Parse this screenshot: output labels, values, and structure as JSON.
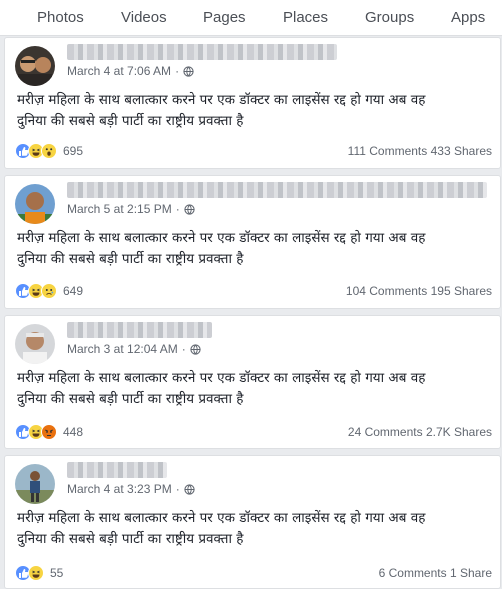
{
  "tabs": [
    "Photos",
    "Videos",
    "Pages",
    "Places",
    "Groups",
    "Apps"
  ],
  "posts": [
    {
      "timestamp": "March 4 at 7:06 AM",
      "text_line1": "मरीज़ महिला के साथ बलात्कार करने पर एक डॉक्टर का लाइसेंस रद्द हो गया अब वह",
      "text_line2": "दुनिया की सबसे बड़ी पार्टी का राष्ट्रीय प्रवक्ता है",
      "reactions": [
        "like",
        "haha",
        "wow"
      ],
      "reaction_count": "695",
      "comments": "111 Comments",
      "shares": "433 Shares"
    },
    {
      "timestamp": "March 5 at 2:15 PM",
      "text_line1": "मरीज़ महिला के साथ बलात्कार करने पर एक डॉक्टर का लाइसेंस रद्द हो गया अब वह",
      "text_line2": "दुनिया की सबसे बड़ी पार्टी का राष्ट्रीय प्रवक्ता है",
      "reactions": [
        "like",
        "haha",
        "sad"
      ],
      "reaction_count": "649",
      "comments": "104 Comments",
      "shares": "195 Shares"
    },
    {
      "timestamp": "March 3 at 12:04 AM",
      "text_line1": "मरीज़ महिला के साथ बलात्कार करने पर एक डॉक्टर का लाइसेंस रद्द हो गया अब वह",
      "text_line2": "दुनिया की सबसे बड़ी पार्टी का राष्ट्रीय प्रवक्ता है",
      "reactions": [
        "like",
        "haha",
        "angry"
      ],
      "reaction_count": "448",
      "comments": "24 Comments",
      "shares": "2.7K Shares"
    },
    {
      "timestamp": "March 4 at 3:23 PM",
      "text_line1": "मरीज़ महिला के साथ बलात्कार करने पर एक डॉक्टर का लाइसेंस रद्द हो गया अब वह",
      "text_line2": "दुनिया की सबसे बड़ी पार्टी का राष्ट्रीय प्रवक्ता है",
      "reactions": [
        "like",
        "haha"
      ],
      "reaction_count": "55",
      "comments": "6 Comments",
      "shares": "1 Share"
    }
  ],
  "icons": {
    "privacy": "globe-icon",
    "reactions": {
      "like": "thumbs-up-icon",
      "haha": "laughing-face-icon",
      "wow": "surprised-face-icon",
      "sad": "sad-face-icon",
      "angry": "angry-face-icon"
    }
  },
  "colors": {
    "like": "#5890ff",
    "face": "#f7d442",
    "angry": "#e9710f",
    "meta": "#616770"
  }
}
